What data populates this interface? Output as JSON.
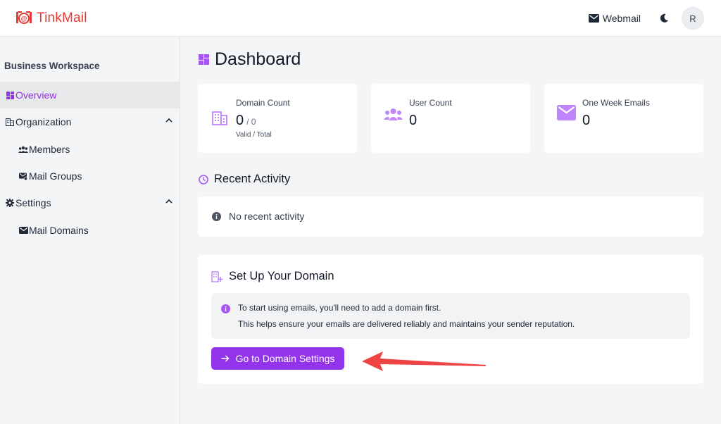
{
  "app": {
    "brand_name": "TinkMail"
  },
  "header": {
    "webmail_label": "Webmail",
    "avatar_initial": "R"
  },
  "sidebar": {
    "workspace_name": "Business Workspace",
    "items": [
      {
        "label": "Overview",
        "icon": "dashboard-icon",
        "active": true
      },
      {
        "label": "Organization",
        "icon": "building-icon",
        "expanded": true
      },
      {
        "label": "Members",
        "icon": "users-icon"
      },
      {
        "label": "Mail Groups",
        "icon": "mail-group-icon"
      },
      {
        "label": "Settings",
        "icon": "gear-icon",
        "expanded": true
      },
      {
        "label": "Mail Domains",
        "icon": "mail-icon"
      }
    ]
  },
  "main": {
    "title": "Dashboard",
    "stats": [
      {
        "label": "Domain Count",
        "value": "0",
        "sub": "/ 0",
        "caption": "Valid / Total",
        "icon": "building-icon"
      },
      {
        "label": "User Count",
        "value": "0",
        "icon": "users-icon"
      },
      {
        "label": "One Week Emails",
        "value": "0",
        "icon": "mail-icon"
      }
    ],
    "recent_activity": {
      "title": "Recent Activity",
      "empty_text": "No recent activity"
    },
    "setup": {
      "title": "Set Up Your Domain",
      "info_line1": "To start using emails, you'll need to add a domain first.",
      "info_line2": "This helps ensure your emails are delivered reliably and maintains your sender reputation.",
      "button_label": "Go to Domain Settings"
    }
  },
  "colors": {
    "accent": "#9333ea",
    "brand": "#e53935",
    "annotation_arrow": "#ef4444"
  }
}
